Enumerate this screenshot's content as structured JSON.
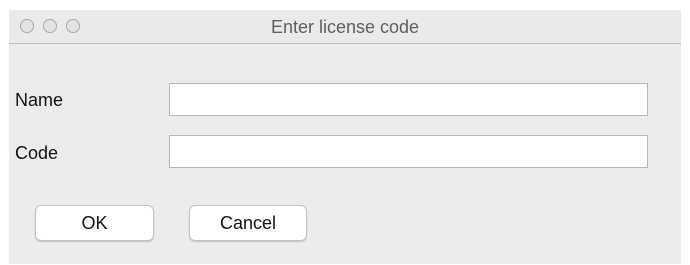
{
  "window": {
    "title": "Enter license code",
    "controls": [
      "close",
      "minimize",
      "zoom"
    ]
  },
  "form": {
    "name_label": "Name",
    "name_value": "",
    "code_label": "Code",
    "code_value": ""
  },
  "buttons": {
    "ok_label": "OK",
    "cancel_label": "Cancel"
  },
  "colors": {
    "window_background": "#ececec",
    "title_text": "#5e5e5e",
    "input_border": "#b7b7b7"
  }
}
